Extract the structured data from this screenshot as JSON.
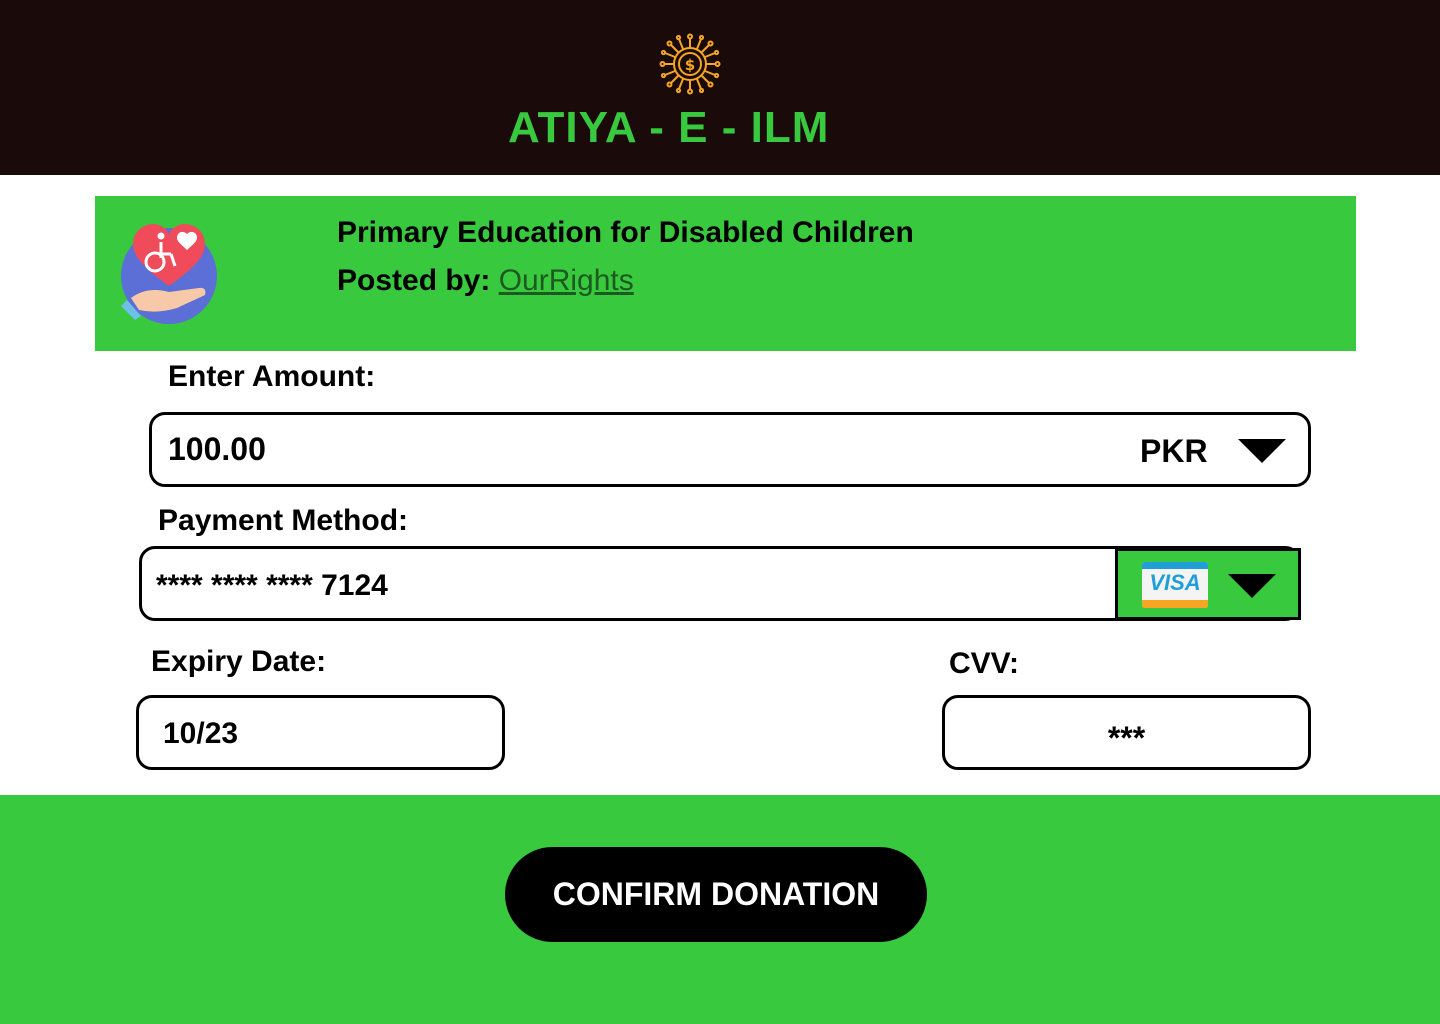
{
  "header": {
    "logo_icon": "dollar-circuit-icon",
    "brand": "ATIYA - E - ILM"
  },
  "campaign": {
    "icon": "disability-heart-hand-icon",
    "title": "Primary Education for Disabled Children",
    "posted_by_label": "Posted by:",
    "posted_by_name": "OurRights"
  },
  "amount": {
    "label": "Enter Amount:",
    "value": "100.00",
    "currency": "PKR"
  },
  "payment": {
    "label": "Payment Method:",
    "card_number": "**** **** **** 7124",
    "card_brand": "VISA"
  },
  "expiry": {
    "label": "Expiry Date:",
    "value": "10/23"
  },
  "cvv": {
    "label": "CVV:",
    "value": "***"
  },
  "confirm_button": "CONFIRM DONATION",
  "colors": {
    "accent": "#39c93f",
    "header_bg": "#1a0a0a",
    "logo": "#f5a623"
  }
}
